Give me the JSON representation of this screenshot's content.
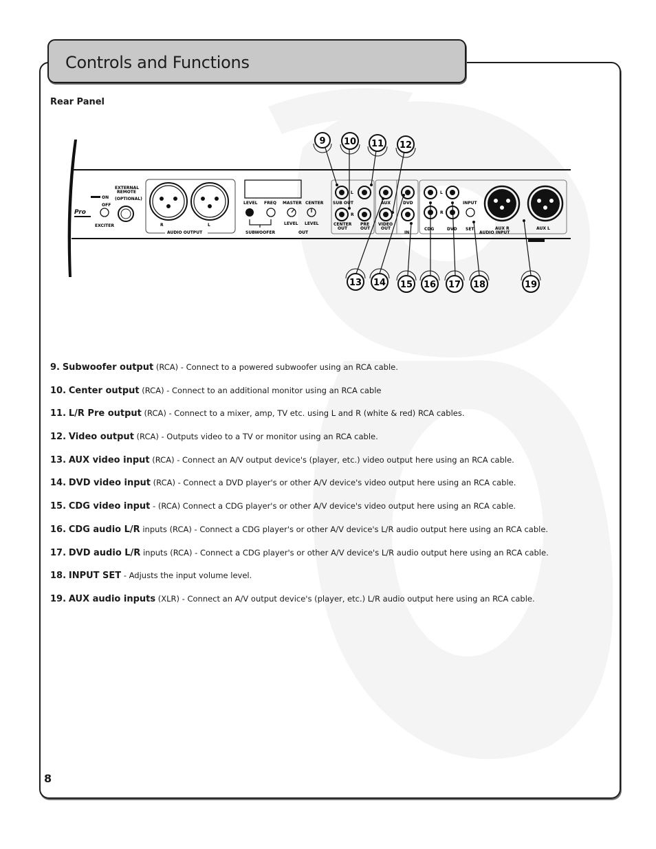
{
  "page": {
    "title": "Controls and Functions",
    "section_label": "Rear Panel",
    "page_number": "8"
  },
  "diagram": {
    "panel_labels": {
      "on": "ON",
      "off": "OFF",
      "exciter": "EXCITER",
      "external_remote": "EXTERNAL",
      "external_remote_2": "REMOTE",
      "optional": "(OPTIONAL)",
      "audio_output": "AUDIO OUTPUT",
      "xlr_r": "R",
      "xlr_l": "L",
      "level": "LEVEL",
      "freq": "FREQ",
      "master": "MASTER",
      "center": "CENTER",
      "subwoofer": "SUBWOOFER",
      "master_level": "LEVEL",
      "center_level": "LEVEL",
      "out": "OUT",
      "sub_out": "SUB OUT",
      "center_out_1": "CENTER",
      "center_out_2": "OUT",
      "pre_out_1": "PRE",
      "pre_out_2": "OUT",
      "l": "L",
      "r": "R",
      "aux": "AUX",
      "dvd": "DVD",
      "video_out_1": "VIDEO",
      "video_out_2": "OUT",
      "in": "IN",
      "cdg": "CDG",
      "dvd_audio": "DVD",
      "input": "INPUT",
      "set": "SET",
      "aux_r": "AUX R",
      "aux_l": "AUX L",
      "audio_input": "AUDIO INPUT"
    },
    "callouts_top": [
      "9",
      "10",
      "11",
      "12"
    ],
    "callouts_bottom": [
      "13",
      "14",
      "15",
      "16",
      "17",
      "18",
      "19"
    ]
  },
  "descriptions": [
    {
      "num": "9.",
      "name": "Subwoofer output",
      "text": " (RCA) - Connect to a powered subwoofer using an RCA cable."
    },
    {
      "num": "10.",
      "name": "Center output",
      "text": " (RCA) - Connect to an additional monitor using an RCA cable"
    },
    {
      "num": "11.",
      "name": "L/R Pre output",
      "text": " (RCA) - Connect to a mixer, amp, TV etc. using L and R (white & red) RCA cables."
    },
    {
      "num": "12.",
      "name": "Video output",
      "text": " (RCA) - Outputs video to a TV or monitor using an RCA cable."
    },
    {
      "num": "13.",
      "name": "AUX video input",
      "text": " (RCA) - Connect an A/V output device's (player, etc.) video output here using an RCA cable."
    },
    {
      "num": "14.",
      "name": "DVD video input",
      "text": " (RCA) - Connect a DVD player's or other A/V device's video output here using an RCA cable."
    },
    {
      "num": "15.",
      "name": "CDG video input",
      "text": " - (RCA) Connect a CDG player's or other A/V device's video output here using an RCA cable."
    },
    {
      "num": "16.",
      "name": "CDG audio L/R",
      "text": " inputs (RCA) - Connect a CDG player's or other A/V device's L/R audio output here using an RCA cable."
    },
    {
      "num": "17.",
      "name": "DVD audio L/R",
      "text": " inputs (RCA) - Connect a CDG player's or other A/V device's L/R audio output here using an RCA cable."
    },
    {
      "num": "18.",
      "name": "INPUT SET",
      "text": " - Adjusts the input volume level."
    },
    {
      "num": "19.",
      "name": "AUX audio inputs",
      "text": " (XLR) - Connect an A/V output device's (player, etc.) L/R audio output here using an RCA cable."
    }
  ],
  "colors": {
    "title_tab_bg": "#c8c8c8",
    "border": "#1c1c1c",
    "watermark": "#f3f3f3"
  }
}
